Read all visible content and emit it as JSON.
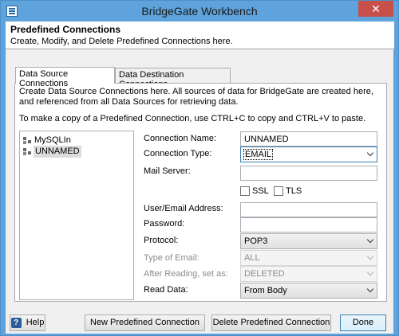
{
  "window": {
    "title": "BridgeGate Workbench",
    "close_glyph": "✕"
  },
  "header": {
    "title": "Predefined Connections",
    "subtitle": "Create, Modify, and Delete Predefined Connections here."
  },
  "tabs": [
    {
      "label": "Data Source Connections",
      "active": true
    },
    {
      "label": "Data Destination Connections",
      "active": false
    }
  ],
  "description": {
    "line1": "Create Data Source Connections here.  All sources of data for BridgeGate are created here,",
    "line2": "and referenced from all Data Sources for retrieving data.",
    "line3": "To make a copy of a Predefined Connection, use CTRL+C to copy and CTRL+V to paste."
  },
  "tree": {
    "items": [
      {
        "label": "MySQLIn",
        "selected": false
      },
      {
        "label": "UNNAMED",
        "selected": true
      }
    ]
  },
  "form": {
    "connection_name": {
      "label": "Connection Name:",
      "value": "UNNAMED"
    },
    "connection_type": {
      "label": "Connection Type:",
      "value": "EMAIL"
    },
    "mail_server": {
      "label": "Mail Server:",
      "value": ""
    },
    "ssl": {
      "label": "SSL",
      "checked": false
    },
    "tls": {
      "label": "TLS",
      "checked": false
    },
    "user_email": {
      "label": "User/Email Address:",
      "value": ""
    },
    "password": {
      "label": "Password:",
      "value": ""
    },
    "protocol": {
      "label": "Protocol:",
      "value": "POP3"
    },
    "type_of_email": {
      "label": "Type of Email:",
      "value": "ALL",
      "disabled": true
    },
    "after_reading": {
      "label": "After Reading, set as:",
      "value": "DELETED",
      "disabled": true
    },
    "read_data": {
      "label": "Read Data:",
      "value": "From Body"
    }
  },
  "buttons": {
    "help": "Help",
    "help_icon_glyph": "?",
    "new": "New Predefined Connection",
    "delete": "Delete Predefined Connection",
    "done": "Done"
  },
  "colors": {
    "titlebar": "#5ea3dc",
    "close_button": "#c7504a",
    "focus_border": "#3c7fb1"
  }
}
